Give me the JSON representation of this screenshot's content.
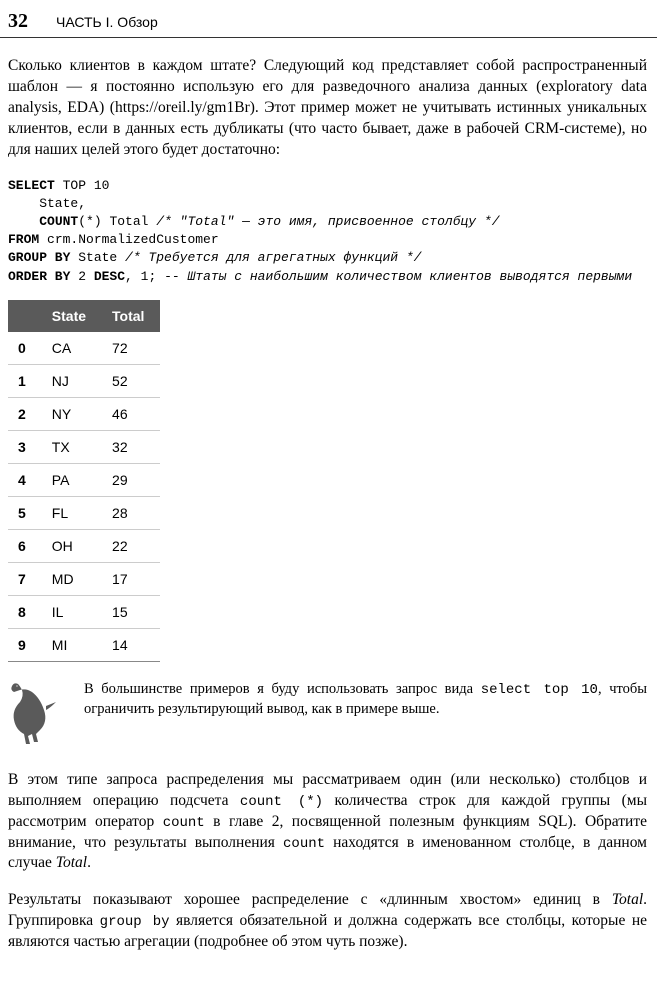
{
  "header": {
    "page_number": "32",
    "section_title": "ЧАСТЬ I. Обзор"
  },
  "para1": "Сколько клиентов в каждом штате? Следующий код представляет собой распространенный шаблон — я постоянно использую его для разведочного анализа данных (exploratory data analysis, EDA) (https://oreil.ly/gm1Br). Этот пример может не учитывать истинных уникальных клиентов, если в данных есть дубликаты (что часто бывает, даже в рабочей CRM-системе), но для наших целей этого будет достаточно:",
  "code": {
    "l1a": "SELECT ",
    "l1b": "TOP 10",
    "l2": "    State,",
    "l3a": "    ",
    "l3b": "COUNT",
    "l3c": "(*) Total ",
    "l3d": "/* \"Total\" — это имя, присвоенное столбцу */",
    "l4a": "FROM ",
    "l4b": "crm.NormalizedCustomer",
    "l5a": "GROUP BY ",
    "l5b": "State ",
    "l5c": "/* Требуется для агрегатных функций */",
    "l6a": "ORDER BY ",
    "l6b": "2 ",
    "l6c": "DESC",
    "l6d": ", 1; ",
    "l6e": "-- Штаты с наибольшим количеством клиентов выводятся первыми"
  },
  "table": {
    "col1": "State",
    "col2": "Total",
    "rows": [
      {
        "i": "0",
        "state": "CA",
        "total": "72"
      },
      {
        "i": "1",
        "state": "NJ",
        "total": "52"
      },
      {
        "i": "2",
        "state": "NY",
        "total": "46"
      },
      {
        "i": "3",
        "state": "TX",
        "total": "32"
      },
      {
        "i": "4",
        "state": "PA",
        "total": "29"
      },
      {
        "i": "5",
        "state": "FL",
        "total": "28"
      },
      {
        "i": "6",
        "state": "OH",
        "total": "22"
      },
      {
        "i": "7",
        "state": "MD",
        "total": "17"
      },
      {
        "i": "8",
        "state": "IL",
        "total": "15"
      },
      {
        "i": "9",
        "state": "MI",
        "total": "14"
      }
    ]
  },
  "note": {
    "t1": "В большинстве примеров я буду использовать запрос вида ",
    "c1": "select top 10",
    "t2": ", чтобы ограничить результирующий вывод, как в примере выше."
  },
  "para2": {
    "t1": "В этом типе запроса распределения мы рассматриваем один (или несколько) столбцов и выполняем операцию подсчета ",
    "c1": "count (*)",
    "t2": " количества строк для каждой группы (мы рассмотрим оператор ",
    "c2": "count",
    "t3": " в главе 2, посвященной полезным функциям SQL). Обратите внимание, что результаты выполнения ",
    "c3": "count",
    "t4": " находятся в именованном столбце, в данном случае ",
    "i1": "Total",
    "t5": "."
  },
  "para3": {
    "t1": "Результаты показывают хорошее распределение с «длинным хвостом» единиц в ",
    "i1": "Total",
    "t2": ". Группировка ",
    "c1": "group by",
    "t3": " является обязательной и должна содержать все столбцы, которые не являются частью агрегации (подробнее об этом чуть позже)."
  }
}
